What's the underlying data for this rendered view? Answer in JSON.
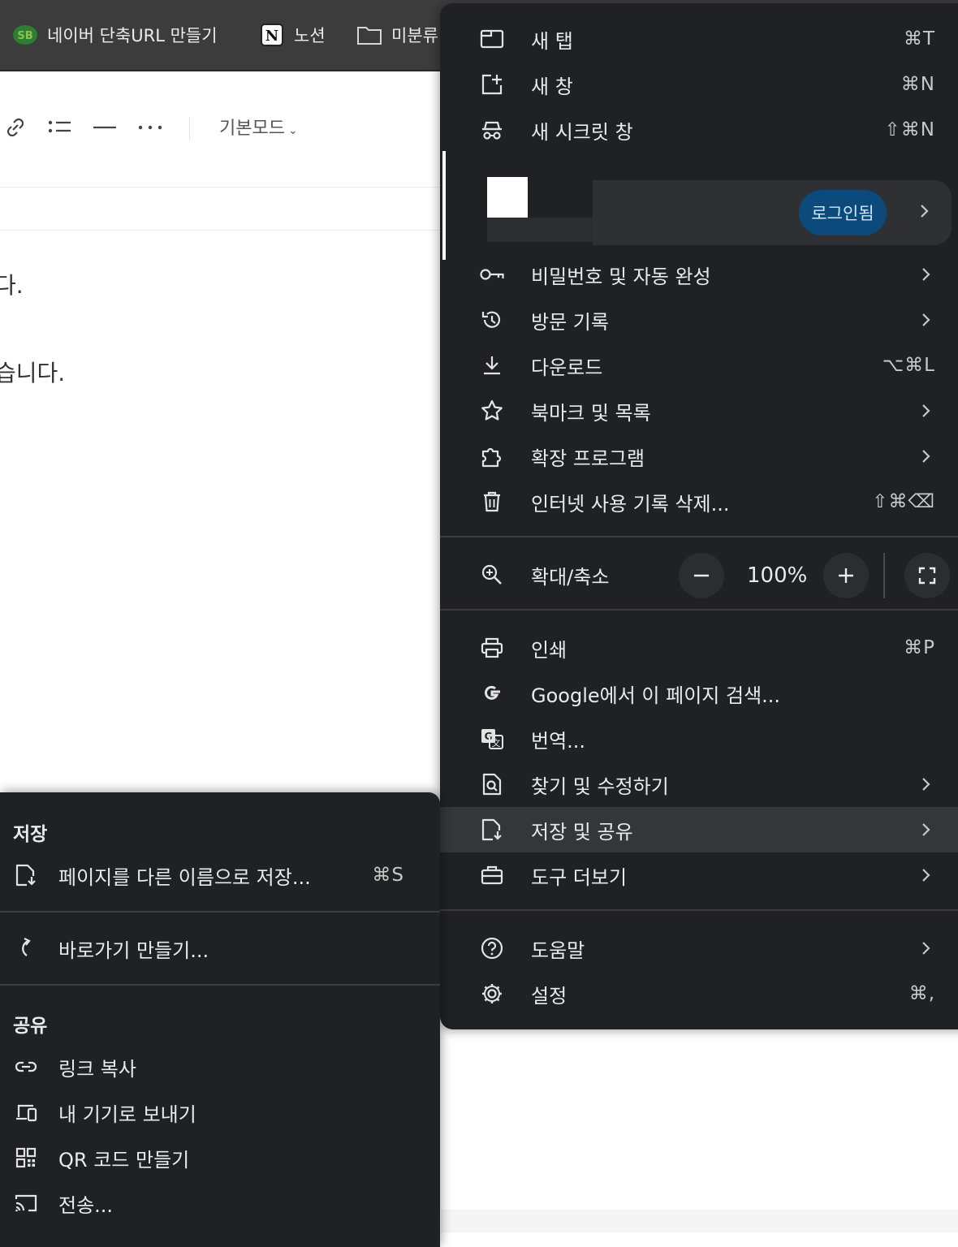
{
  "bookmarks": [
    {
      "label": "네이버 단축URL 만들기",
      "icon": "sb-logo-icon"
    },
    {
      "label": "노션",
      "icon": "notion-icon"
    },
    {
      "label": "미분류",
      "icon": "folder-icon"
    }
  ],
  "editor": {
    "mode_label": "기본모드",
    "line1": "다.",
    "line2": "습니다."
  },
  "menu": {
    "new_tab": {
      "label": "새 탭",
      "shortcut": "⌘T"
    },
    "new_window": {
      "label": "새 창",
      "shortcut": "⌘N"
    },
    "incognito": {
      "label": "새 시크릿 창",
      "shortcut": "⇧⌘N"
    },
    "profile": {
      "signin_label": "로그인됨"
    },
    "passwords": {
      "label": "비밀번호 및 자동 완성"
    },
    "history": {
      "label": "방문 기록"
    },
    "downloads": {
      "label": "다운로드",
      "shortcut": "⌥⌘L"
    },
    "bookmarks": {
      "label": "북마크 및 목록"
    },
    "extensions": {
      "label": "확장 프로그램"
    },
    "clear_data": {
      "label": "인터넷 사용 기록 삭제...",
      "shortcut": "⇧⌘⌫"
    },
    "zoom": {
      "label": "확대/축소",
      "value": "100%"
    },
    "print": {
      "label": "인쇄",
      "shortcut": "⌘P"
    },
    "search_page": {
      "label": "Google에서 이 페이지 검색..."
    },
    "translate": {
      "label": "번역..."
    },
    "find_edit": {
      "label": "찾기 및 수정하기"
    },
    "save_share": {
      "label": "저장 및 공유"
    },
    "more_tools": {
      "label": "도구 더보기"
    },
    "help": {
      "label": "도움말"
    },
    "settings": {
      "label": "설정",
      "shortcut": "⌘,"
    }
  },
  "submenu": {
    "save_heading": "저장",
    "save_as": {
      "label": "페이지를 다른 이름으로 저장...",
      "shortcut": "⌘S"
    },
    "shortcut": {
      "label": "바로가기 만들기..."
    },
    "share_heading": "공유",
    "copy_link": {
      "label": "링크 복사"
    },
    "send_device": {
      "label": "내 기기로 보내기"
    },
    "qr_code": {
      "label": "QR 코드 만들기"
    },
    "cast": {
      "label": "전송..."
    }
  },
  "colors": {
    "menu_bg": "#202124",
    "highlight": "#35363a",
    "signin_badge": "#0b4a7a",
    "bookmarks_bar": "#3c3c3c"
  }
}
